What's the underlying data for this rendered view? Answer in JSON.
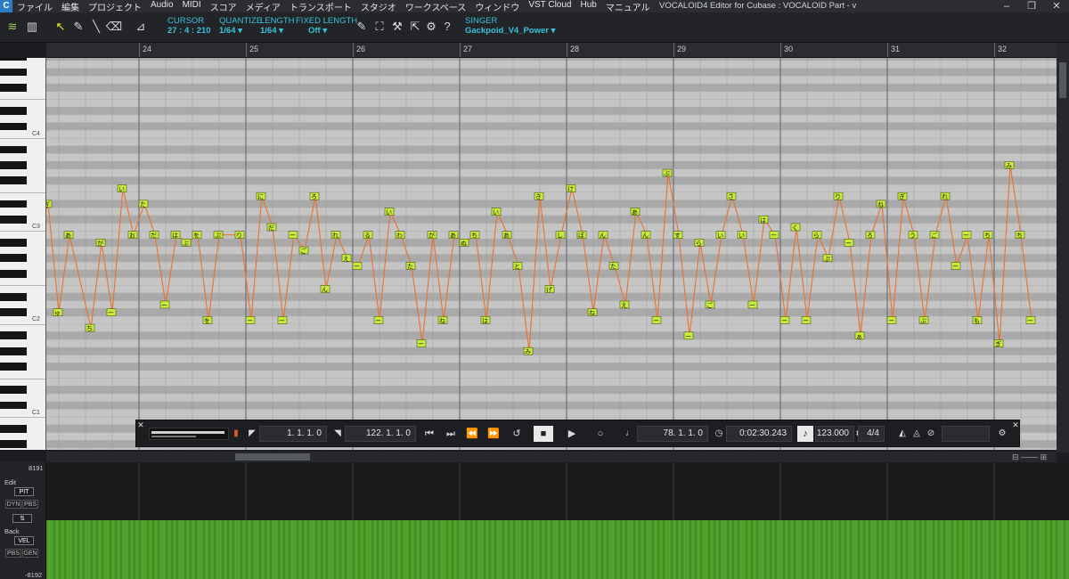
{
  "menu": {
    "items": [
      "ファイル",
      "編集",
      "プロジェクト",
      "Audio",
      "MIDI",
      "スコア",
      "メディア",
      "トランスポート",
      "スタジオ",
      "ワークスペース",
      "ウィンドウ",
      "VST Cloud",
      "Hub",
      "マニュアル"
    ],
    "window_title": "VOCALOID4 Editor for Cubase : VOCALOID Part - v"
  },
  "toolbar": {
    "cursor_label": "CURSOR",
    "cursor_value": "27 : 4 : 210",
    "quantize_label": "QUANTIZE",
    "quantize_value": "1/64 ▾",
    "length_label": "LENGTH",
    "length_value": "1/64 ▾",
    "fixed_label": "FIXED LENGTH",
    "fixed_value": "Off ▾",
    "singer_label": "SINGER",
    "singer_value": "Gackpoid_V4_Power ▾"
  },
  "ruler": {
    "bars": [
      "24",
      "25",
      "26",
      "27",
      "28",
      "29",
      "30",
      "31",
      "32"
    ]
  },
  "keys": {
    "labels": [
      "C4",
      "C3",
      "C2",
      "C1"
    ]
  },
  "notes": [
    {
      "b": 23.0,
      "p": 47,
      "t": "ぼ"
    },
    {
      "b": 23.1,
      "p": 51,
      "t": "ぎ"
    },
    {
      "b": 23.2,
      "p": 37,
      "t": "ゅ"
    },
    {
      "b": 23.3,
      "p": 47,
      "t": "あ"
    },
    {
      "b": 23.5,
      "p": 35,
      "t": "ち"
    },
    {
      "b": 23.6,
      "p": 46,
      "t": "が"
    },
    {
      "b": 23.7,
      "p": 37,
      "t": "ー"
    },
    {
      "b": 23.8,
      "p": 53,
      "t": "い"
    },
    {
      "b": 23.9,
      "p": 47,
      "t": "お"
    },
    {
      "b": 24.0,
      "p": 51,
      "t": "た"
    },
    {
      "b": 24.1,
      "p": 47,
      "t": "だ"
    },
    {
      "b": 24.2,
      "p": 38,
      "t": "ー"
    },
    {
      "b": 24.3,
      "p": 47,
      "t": "は"
    },
    {
      "b": 24.4,
      "p": 46,
      "t": "ぶ"
    },
    {
      "b": 24.5,
      "p": 47,
      "t": "を"
    },
    {
      "b": 24.6,
      "p": 36,
      "t": "を"
    },
    {
      "b": 24.7,
      "p": 47,
      "t": "ぷ"
    },
    {
      "b": 24.9,
      "p": 47,
      "t": "り"
    },
    {
      "b": 25.0,
      "p": 36,
      "t": "ー"
    },
    {
      "b": 25.1,
      "p": 52,
      "t": "に"
    },
    {
      "b": 25.2,
      "p": 48,
      "t": "だ"
    },
    {
      "b": 25.3,
      "p": 36,
      "t": "ー"
    },
    {
      "b": 25.4,
      "p": 47,
      "t": "ー"
    },
    {
      "b": 25.5,
      "p": 45,
      "t": "ご"
    },
    {
      "b": 25.6,
      "p": 52,
      "t": "ろ"
    },
    {
      "b": 25.7,
      "p": 40,
      "t": "ん"
    },
    {
      "b": 25.8,
      "p": 47,
      "t": "れ"
    },
    {
      "b": 25.9,
      "p": 44,
      "t": "え"
    },
    {
      "b": 26.0,
      "p": 43,
      "t": "ー"
    },
    {
      "b": 26.1,
      "p": 47,
      "t": "る"
    },
    {
      "b": 26.2,
      "p": 36,
      "t": "ー"
    },
    {
      "b": 26.3,
      "p": 50,
      "t": "い"
    },
    {
      "b": 26.4,
      "p": 47,
      "t": "わ"
    },
    {
      "b": 26.5,
      "p": 43,
      "t": "た"
    },
    {
      "b": 26.6,
      "p": 33,
      "t": "ー"
    },
    {
      "b": 26.7,
      "p": 47,
      "t": "が"
    },
    {
      "b": 26.8,
      "p": 36,
      "t": "ね"
    },
    {
      "b": 26.9,
      "p": 47,
      "t": "あ"
    },
    {
      "b": 27.0,
      "p": 46,
      "t": "ぬ"
    },
    {
      "b": 27.1,
      "p": 47,
      "t": "ち"
    },
    {
      "b": 27.2,
      "p": 36,
      "t": "は"
    },
    {
      "b": 27.3,
      "p": 50,
      "t": "い"
    },
    {
      "b": 27.4,
      "p": 47,
      "t": "あ"
    },
    {
      "b": 27.5,
      "p": 43,
      "t": "と"
    },
    {
      "b": 27.6,
      "p": 32,
      "t": "み"
    },
    {
      "b": 27.7,
      "p": 52,
      "t": "き"
    },
    {
      "b": 27.8,
      "p": 40,
      "t": "げ"
    },
    {
      "b": 27.9,
      "p": 47,
      "t": "し"
    },
    {
      "b": 28.0,
      "p": 53,
      "t": "け"
    },
    {
      "b": 28.1,
      "p": 47,
      "t": "ぼ"
    },
    {
      "b": 28.2,
      "p": 37,
      "t": "ね"
    },
    {
      "b": 28.3,
      "p": 47,
      "t": "ん"
    },
    {
      "b": 28.4,
      "p": 43,
      "t": "た"
    },
    {
      "b": 28.5,
      "p": 38,
      "t": "え"
    },
    {
      "b": 28.6,
      "p": 50,
      "t": "あ"
    },
    {
      "b": 28.7,
      "p": 47,
      "t": "ん"
    },
    {
      "b": 28.8,
      "p": 36,
      "t": "ー"
    },
    {
      "b": 28.9,
      "p": 55,
      "t": "ぶ"
    },
    {
      "b": 29.0,
      "p": 47,
      "t": "す"
    },
    {
      "b": 29.1,
      "p": 34,
      "t": "ー"
    },
    {
      "b": 29.2,
      "p": 46,
      "t": "ら"
    },
    {
      "b": 29.3,
      "p": 38,
      "t": "ご"
    },
    {
      "b": 29.4,
      "p": 47,
      "t": "い"
    },
    {
      "b": 29.5,
      "p": 52,
      "t": "さ"
    },
    {
      "b": 29.6,
      "p": 47,
      "t": "い"
    },
    {
      "b": 29.7,
      "p": 38,
      "t": "ー"
    },
    {
      "b": 29.8,
      "p": 49,
      "t": "は"
    },
    {
      "b": 29.9,
      "p": 47,
      "t": "ー"
    },
    {
      "b": 30.0,
      "p": 36,
      "t": "ー"
    },
    {
      "b": 30.1,
      "p": 48,
      "t": "く"
    },
    {
      "b": 30.2,
      "p": 36,
      "t": "ー"
    },
    {
      "b": 30.3,
      "p": 47,
      "t": "ら"
    },
    {
      "b": 30.4,
      "p": 44,
      "t": "ぷ"
    },
    {
      "b": 30.5,
      "p": 52,
      "t": "り"
    },
    {
      "b": 30.6,
      "p": 46,
      "t": "ー"
    },
    {
      "b": 30.7,
      "p": 34,
      "t": "ぁ"
    },
    {
      "b": 30.8,
      "p": 47,
      "t": "ろ"
    },
    {
      "b": 30.9,
      "p": 51,
      "t": "ね"
    },
    {
      "b": 31.0,
      "p": 36,
      "t": "ー"
    },
    {
      "b": 31.1,
      "p": 52,
      "t": "ぎ"
    },
    {
      "b": 31.2,
      "p": 47,
      "t": "う"
    },
    {
      "b": 31.3,
      "p": 36,
      "t": "ぶ"
    },
    {
      "b": 31.4,
      "p": 47,
      "t": "ご"
    },
    {
      "b": 31.5,
      "p": 52,
      "t": "れ"
    },
    {
      "b": 31.6,
      "p": 43,
      "t": "ー"
    },
    {
      "b": 31.7,
      "p": 47,
      "t": "ー"
    },
    {
      "b": 31.8,
      "p": 36,
      "t": "も"
    },
    {
      "b": 31.9,
      "p": 47,
      "t": "ち"
    },
    {
      "b": 32.0,
      "p": 33,
      "t": "ぎ"
    },
    {
      "b": 32.1,
      "p": 56,
      "t": "み"
    },
    {
      "b": 32.2,
      "p": 47,
      "t": "ち"
    },
    {
      "b": 32.3,
      "p": 36,
      "t": "ー"
    }
  ],
  "transport": {
    "left_locator": "1. 1. 1.   0",
    "right_locator": "122. 1. 1.   0",
    "position_bars": "78. 1. 1.   0",
    "time": "0:02:30.243",
    "tempo": "123.000",
    "signature": "4/4"
  },
  "lane": {
    "top_value": "8191",
    "bottom_value": "-8192",
    "edit_label": "Edit",
    "edit_param": "PIT",
    "dyn": "DYN",
    "pbs": "PBS",
    "back_label": "Back",
    "back_param": "VEL",
    "pbs2": "PBS",
    "gen": "GEN"
  },
  "colors": {
    "note": "#c8ec3c",
    "pitch": "#e8732c",
    "velocity": "#4a9c28",
    "accent": "#3ac1d9"
  }
}
